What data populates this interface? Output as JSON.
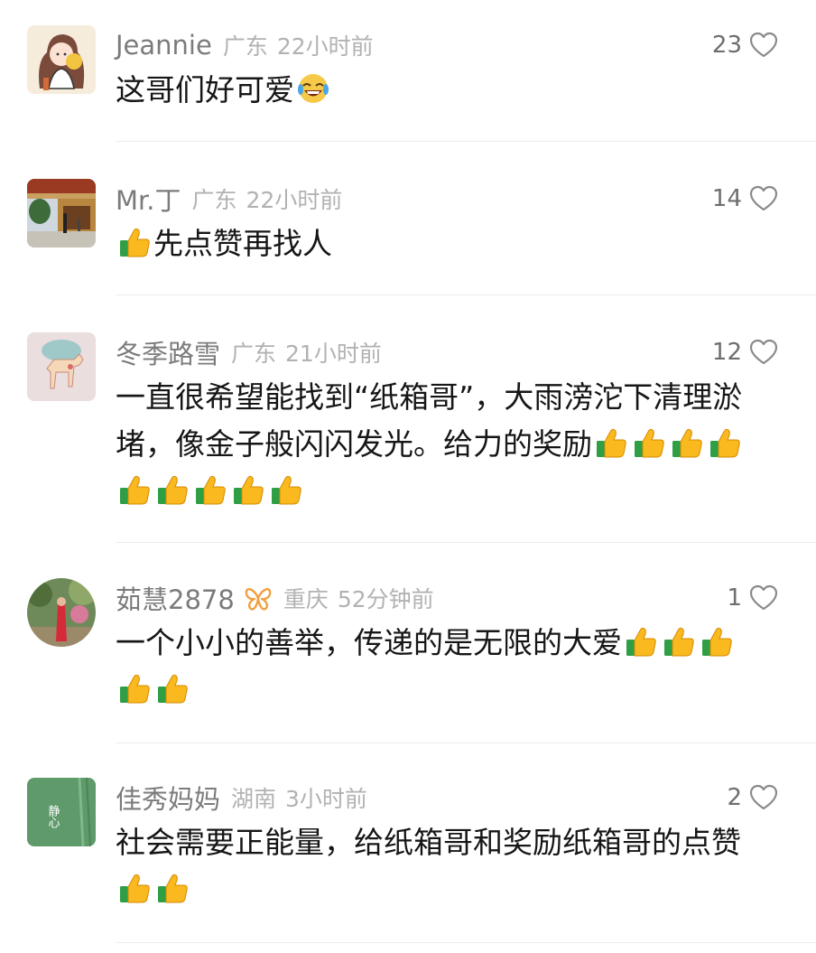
{
  "comments": [
    {
      "name": "Jeannie",
      "location": "广东",
      "time": "22小时前",
      "likes": "23",
      "text": "这哥们好可爱",
      "emoji": [
        "laughing-crying"
      ],
      "avatar": "cartoon-girl"
    },
    {
      "name": "Mr.丁",
      "location": "广东",
      "time": "22小时前",
      "likes": "14",
      "text_before": "",
      "text": "先点赞再找人",
      "emoji_before": [
        "thumbs-up"
      ],
      "avatar": "temple-photo"
    },
    {
      "name": "冬季路雪",
      "location": "广东",
      "time": "21小时前",
      "likes": "12",
      "text": "一直很希望能找到“纸箱哥”，大雨滂沱下清理淤堵，像金子般闪闪发光。给力的奖励",
      "emoji": [
        "thumbs-up",
        "thumbs-up",
        "thumbs-up",
        "thumbs-up",
        "thumbs-up",
        "thumbs-up",
        "thumbs-up",
        "thumbs-up",
        "thumbs-up"
      ],
      "avatar": "deer-brooch"
    },
    {
      "name": "茹慧2878",
      "badge": "butterfly-badge",
      "badge_color": "#f0a040",
      "location": "重庆",
      "time": "52分钟前",
      "likes": "1",
      "text": "一个小小的善举，传递的是无限的大爱",
      "emoji": [
        "thumbs-up",
        "thumbs-up",
        "thumbs-up",
        "thumbs-up",
        "thumbs-up"
      ],
      "avatar": "garden-photo"
    },
    {
      "name": "佳秀妈妈",
      "location": "湖南",
      "time": "3小时前",
      "likes": "2",
      "text": "社会需要正能量，给纸箱哥和奖励纸箱哥的点赞",
      "emoji": [
        "thumbs-up",
        "thumbs-up"
      ],
      "avatar": "calligraphy-green",
      "avatar_text": "静心"
    }
  ],
  "colors": {
    "name": "#7b7b7b",
    "meta": "#b2b2b2",
    "text": "#161616",
    "divider": "#ececec",
    "heart": "#8a8a8a"
  }
}
